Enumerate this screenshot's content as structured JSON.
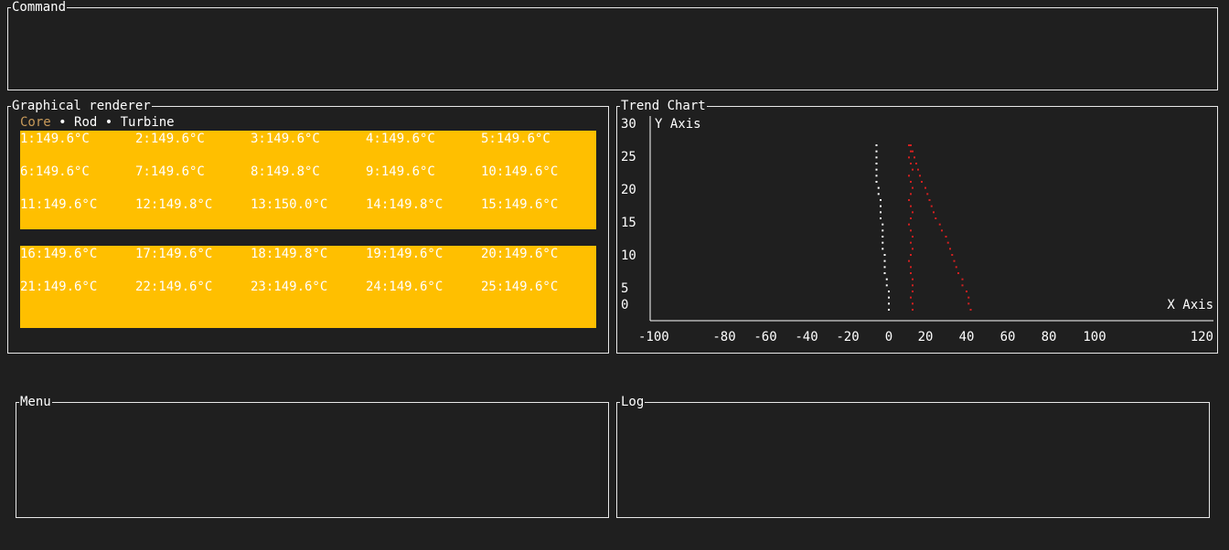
{
  "panels": {
    "command": "Command",
    "graphical": "Graphical renderer",
    "trend": "Trend Chart",
    "menu": "Menu",
    "log": "Log"
  },
  "tabs": {
    "core": "Core",
    "rod": "Rod",
    "turbine": "Turbine",
    "separator": "•"
  },
  "colors": {
    "background": "#1f1f1f",
    "cell_block": "#ffbf00",
    "active_tab": "#c89a5a",
    "series_white": "#ffffff",
    "series_red": "#d42020"
  },
  "grid": {
    "block1": [
      "1:149.6°C",
      "2:149.6°C",
      "3:149.6°C",
      "4:149.6°C",
      "5:149.6°C",
      "6:149.6°C",
      "7:149.6°C",
      "8:149.8°C",
      "9:149.6°C",
      "10:149.6°C",
      "11:149.6°C",
      "12:149.8°C",
      "13:150.0°C",
      "14:149.8°C",
      "15:149.6°C"
    ],
    "block2": [
      "16:149.6°C",
      "17:149.6°C",
      "18:149.8°C",
      "19:149.6°C",
      "20:149.6°C",
      "21:149.6°C",
      "22:149.6°C",
      "23:149.6°C",
      "24:149.6°C",
      "25:149.6°C"
    ]
  },
  "chart_data": {
    "type": "scatter",
    "xlabel": "X Axis",
    "ylabel": "Y Axis",
    "xlim": [
      -100,
      120
    ],
    "ylim": [
      0,
      30
    ],
    "x_ticks": [
      -100,
      -80,
      -60,
      -40,
      -20,
      0,
      20,
      40,
      60,
      80,
      100,
      120
    ],
    "y_ticks": [
      0,
      5,
      10,
      15,
      20,
      25,
      30
    ],
    "series": [
      {
        "color": "#ffffff",
        "points": [
          [
            0,
            0
          ],
          [
            0,
            1
          ],
          [
            0,
            2
          ],
          [
            0,
            3
          ],
          [
            -1,
            4
          ],
          [
            -1,
            5
          ],
          [
            -2,
            6
          ],
          [
            -2,
            7
          ],
          [
            -2,
            8
          ],
          [
            -2,
            9
          ],
          [
            -3,
            10
          ],
          [
            -3,
            11
          ],
          [
            -3,
            12
          ],
          [
            -3,
            13
          ],
          [
            -3,
            14
          ],
          [
            -4,
            15
          ],
          [
            -4,
            16
          ],
          [
            -4,
            17
          ],
          [
            -4,
            18
          ],
          [
            -5,
            19
          ],
          [
            -5,
            20
          ],
          [
            -6,
            21
          ],
          [
            -6,
            22
          ],
          [
            -6,
            23
          ],
          [
            -6,
            24
          ],
          [
            -6,
            25
          ],
          [
            -6,
            26
          ],
          [
            -6,
            27
          ]
        ]
      },
      {
        "color": "#d42020",
        "points": [
          [
            13,
            0
          ],
          [
            13,
            1
          ],
          [
            12,
            2
          ],
          [
            13,
            3
          ],
          [
            13,
            4
          ],
          [
            13,
            5
          ],
          [
            12,
            6
          ],
          [
            12,
            7
          ],
          [
            11,
            8
          ],
          [
            12,
            9
          ],
          [
            13,
            10
          ],
          [
            12,
            11
          ],
          [
            13,
            12
          ],
          [
            12,
            13
          ],
          [
            11,
            14
          ],
          [
            12,
            15
          ],
          [
            13,
            16
          ],
          [
            12,
            17
          ],
          [
            11,
            18
          ],
          [
            12,
            19
          ],
          [
            13,
            20
          ],
          [
            12,
            21
          ],
          [
            11,
            22
          ],
          [
            13,
            23
          ],
          [
            12,
            24
          ],
          [
            11,
            25
          ],
          [
            12,
            26
          ],
          [
            11,
            27
          ],
          [
            42,
            0
          ],
          [
            41,
            1
          ],
          [
            41,
            2
          ],
          [
            40,
            3
          ],
          [
            38,
            4
          ],
          [
            38,
            5
          ],
          [
            36,
            6
          ],
          [
            35,
            7
          ],
          [
            34,
            8
          ],
          [
            33,
            9
          ],
          [
            32,
            10
          ],
          [
            31,
            11
          ],
          [
            30,
            12
          ],
          [
            28,
            13
          ],
          [
            27,
            14
          ],
          [
            25,
            15
          ],
          [
            24,
            16
          ],
          [
            23,
            17
          ],
          [
            22,
            18
          ],
          [
            21,
            19
          ],
          [
            20,
            20
          ],
          [
            18,
            21
          ],
          [
            17,
            22
          ],
          [
            16,
            23
          ],
          [
            15,
            24
          ],
          [
            14,
            25
          ],
          [
            13,
            26
          ],
          [
            12,
            27
          ]
        ]
      }
    ]
  }
}
